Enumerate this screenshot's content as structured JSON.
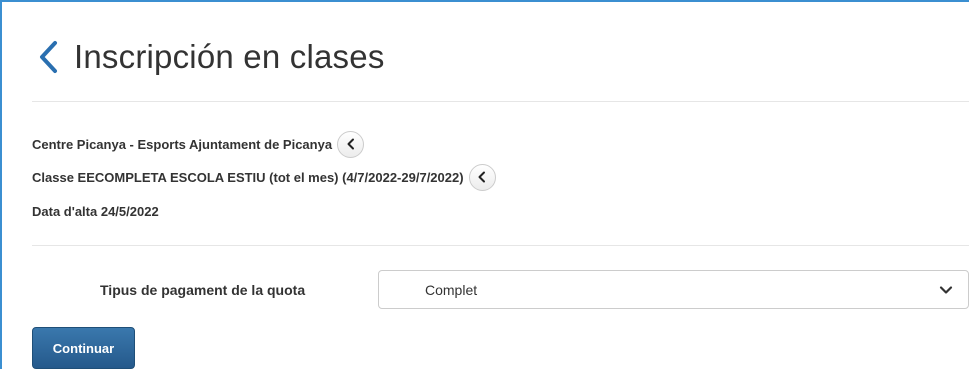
{
  "header": {
    "title": "Inscripción en clases",
    "back_icon": "chevron-left-icon"
  },
  "info": {
    "centre": "Centre Picanya - Esports Ajuntament de Picanya",
    "classe": "Classe EECOMPLETA ESCOLA ESTIU (tot el mes) (4/7/2022-29/7/2022)",
    "data_alta": "Data d'alta 24/5/2022"
  },
  "form": {
    "payment_label": "Tipus de pagament de la quota",
    "payment_selected": "Complet"
  },
  "actions": {
    "continue_label": "Continuar"
  },
  "colors": {
    "accent": "#3b8fd1",
    "primary_button": "#2d6a9f",
    "text": "#333333"
  }
}
